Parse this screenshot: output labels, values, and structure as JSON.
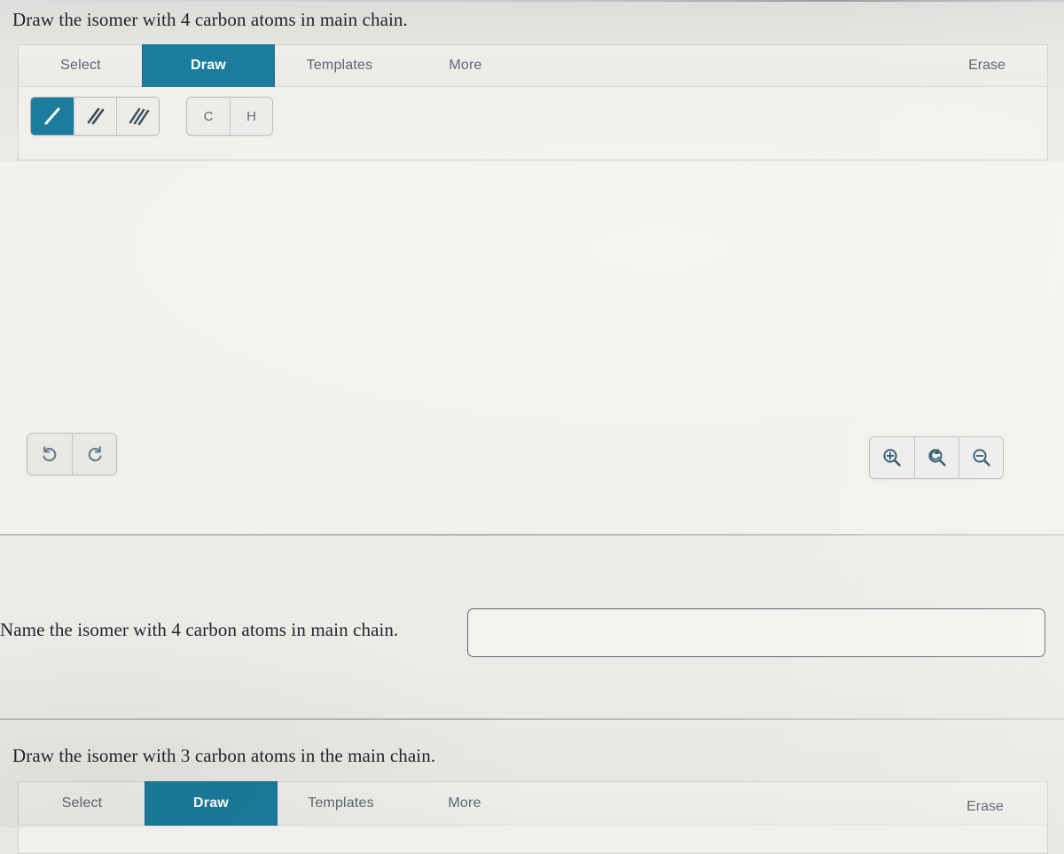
{
  "sections": [
    {
      "id": "section-draw-4c",
      "prompt": "Draw the isomer with 4 carbon atoms in main chain.",
      "editor": {
        "tabs": [
          {
            "label": "Select",
            "active": false
          },
          {
            "label": "Draw",
            "active": true
          },
          {
            "label": "Templates",
            "active": false
          },
          {
            "label": "More",
            "active": false
          }
        ],
        "erase_label": "Erase",
        "bond_tools": [
          {
            "name": "single-bond",
            "order": 1,
            "selected": true
          },
          {
            "name": "double-bond",
            "order": 2,
            "selected": false
          },
          {
            "name": "triple-bond",
            "order": 3,
            "selected": false
          }
        ],
        "element_tools": [
          {
            "label": "C",
            "selected": false
          },
          {
            "label": "H",
            "selected": false
          }
        ],
        "history_tools": [
          {
            "name": "undo-icon"
          },
          {
            "name": "redo-icon"
          }
        ],
        "zoom_tools": [
          {
            "name": "zoom-in-icon"
          },
          {
            "name": "zoom-reset-icon"
          },
          {
            "name": "zoom-out-icon"
          }
        ]
      }
    },
    {
      "id": "section-name-4c",
      "prompt": "Name the isomer with 4 carbon atoms in main chain.",
      "answer": {
        "value": "",
        "placeholder": ""
      }
    },
    {
      "id": "section-draw-3c",
      "prompt": "Draw the isomer with 3 carbon atoms in the main chain.",
      "editor": {
        "tabs": [
          {
            "label": "Select",
            "active": false
          },
          {
            "label": "Draw",
            "active": true
          },
          {
            "label": "Templates",
            "active": false
          },
          {
            "label": "More",
            "active": false
          }
        ],
        "erase_label": "Erase"
      }
    }
  ],
  "colors": {
    "accent": "#1b7c9b",
    "tab_text": "#5b6672",
    "prompt_text": "#23252b",
    "canvas": "#f2f1ed",
    "panel_border": "#d2d1cd",
    "input_border": "#6a6472"
  }
}
